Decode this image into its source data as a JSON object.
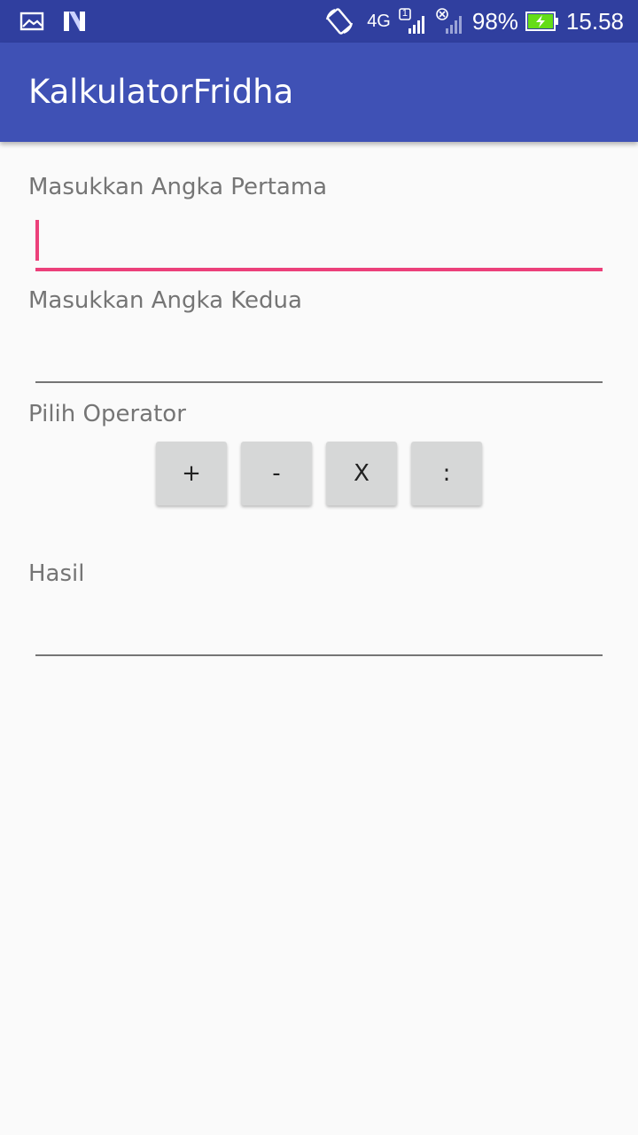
{
  "status_bar": {
    "network": "4G",
    "sim_badge": "1",
    "battery_percent": "98%",
    "time": "15.58",
    "icons": [
      "image-icon",
      "n-icon",
      "auto-rotate-icon",
      "signal-icon",
      "no-sim-icon",
      "battery-charging-icon"
    ]
  },
  "app_bar": {
    "title": "KalkulatorFridha"
  },
  "form": {
    "first_label": "Masukkan Angka Pertama",
    "first_value": "",
    "second_label": "Masukkan Angka Kedua",
    "second_value": "",
    "operator_label": "Pilih Operator",
    "operators": [
      "+",
      "-",
      "X",
      ":"
    ],
    "result_label": "Hasil",
    "result_value": ""
  },
  "colors": {
    "status_bar": "#303f9f",
    "app_bar": "#3f51b5",
    "accent": "#ec407a",
    "battery_fill": "#64dd17"
  }
}
